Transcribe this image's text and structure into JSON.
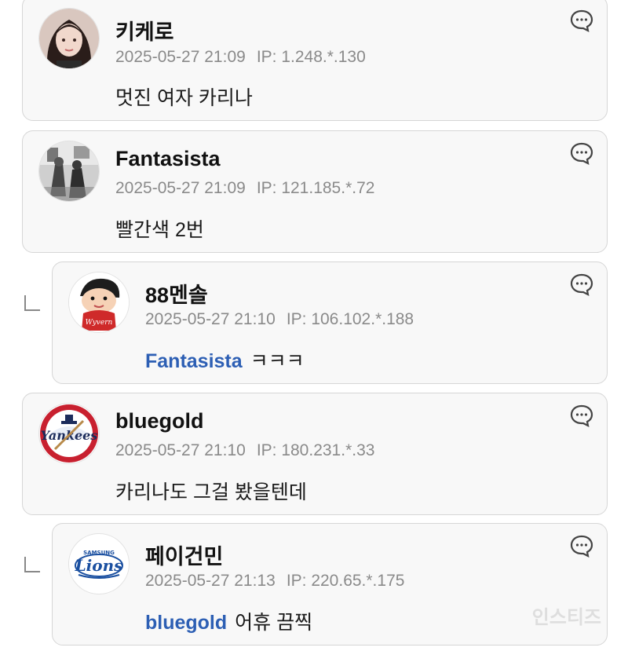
{
  "comments": [
    {
      "author": "키케로",
      "date": "2025-05-27 21:09",
      "ip": "IP: 1.248.*.130",
      "text": "멋진 여자 카리나",
      "avatar_icon": "woman-portrait-avatar"
    },
    {
      "author": "Fantasista",
      "date": "2025-05-27 21:09",
      "ip": "IP: 121.185.*.72",
      "text": "빨간색 2번",
      "avatar_icon": "black-and-white-photo-avatar"
    },
    {
      "author": "88멘솔",
      "date": "2025-05-27 21:10",
      "ip": "IP: 106.102.*.188",
      "mention": "Fantasista",
      "text": "ㅋㅋㅋ",
      "avatar_icon": "cartoon-boy-avatar"
    },
    {
      "author": "bluegold",
      "date": "2025-05-27 21:10",
      "ip": "IP: 180.231.*.33",
      "text": "카리나도 그걸 봤을텐데",
      "avatar_icon": "yankees-logo-avatar"
    },
    {
      "author": "페이건민",
      "date": "2025-05-27 21:13",
      "ip": "IP: 220.65.*.175",
      "mention": "bluegold",
      "text": "어휴 끔찍",
      "avatar_icon": "lions-logo-avatar"
    }
  ],
  "watermark": "인스티즈",
  "colors": {
    "mention": "#2d5fb4",
    "card_bg": "#f8f8f8",
    "card_border": "#d6d6d6",
    "meta_text": "#8a8a8a"
  }
}
